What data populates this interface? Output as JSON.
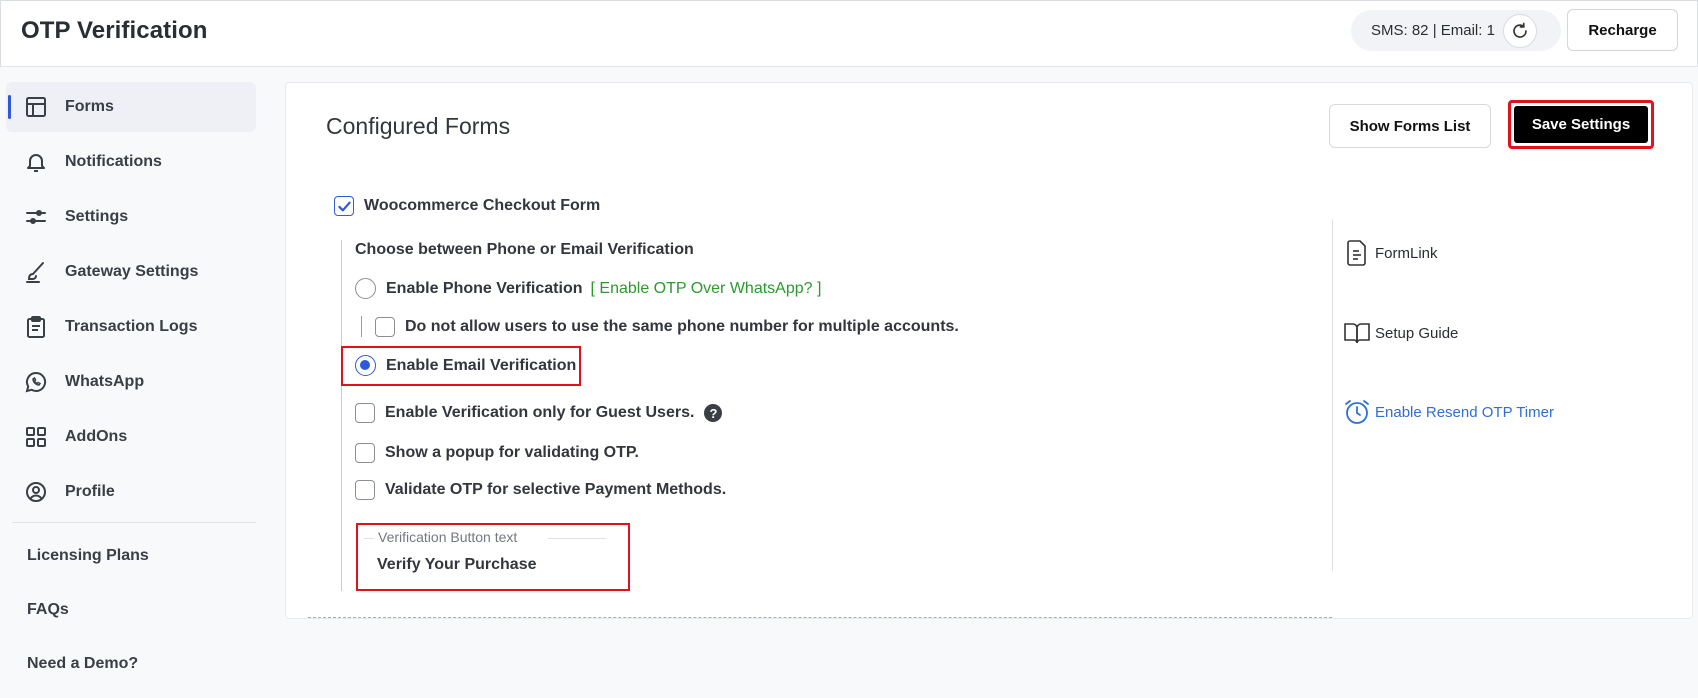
{
  "header": {
    "title": "OTP Verification",
    "quota_text": "SMS: 82 | Email: 1",
    "recharge_label": "Recharge"
  },
  "sidebar": {
    "items": [
      {
        "label": "Forms",
        "icon": "forms-layout-icon",
        "active": true
      },
      {
        "label": "Notifications",
        "icon": "bell-icon"
      },
      {
        "label": "Settings",
        "icon": "sliders-icon"
      },
      {
        "label": "Gateway Settings",
        "icon": "brush-icon"
      },
      {
        "label": "Transaction Logs",
        "icon": "clipboard-icon"
      },
      {
        "label": "WhatsApp",
        "icon": "whatsapp-icon"
      },
      {
        "label": "AddOns",
        "icon": "grid-icon"
      },
      {
        "label": "Profile",
        "icon": "user-circle-icon"
      }
    ],
    "links": [
      "Licensing Plans",
      "FAQs",
      "Need a Demo?"
    ]
  },
  "main": {
    "title": "Configured Forms",
    "show_forms_label": "Show Forms List",
    "save_label": "Save Settings",
    "form_name": "Woocommerce Checkout Form",
    "choose_label": "Choose between Phone or Email Verification",
    "phone_label": "Enable Phone Verification",
    "whatsapp_link": "[ Enable OTP Over WhatsApp? ]",
    "phone_unique_label": "Do not allow users to use the same phone number for multiple accounts.",
    "email_label": "Enable Email Verification",
    "guest_label": "Enable Verification only for Guest Users.",
    "help_glyph": "?",
    "popup_label": "Show a popup for validating OTP.",
    "payment_label": "Validate OTP for selective Payment Methods.",
    "button_text_legend": "Verification Button text",
    "button_text_value": "Verify Your Purchase"
  },
  "side_links": {
    "formlink": "FormLink",
    "setup_guide": "Setup Guide",
    "resend_timer": "Enable Resend OTP Timer"
  },
  "colors": {
    "accent": "#2e59d9",
    "highlight": "#e0121c",
    "whatsapp_green": "#2c9a2c",
    "link_blue": "#2e6fd6"
  }
}
